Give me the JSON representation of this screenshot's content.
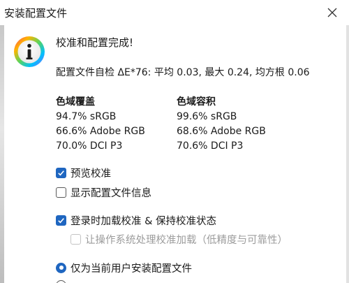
{
  "window": {
    "title": "安装配置文件"
  },
  "dialog": {
    "heading": "校准和配置完成!",
    "profile_check": "配置文件自检 ΔE*76: 平均 0.03, 最大 0.24, 均方根 0.06",
    "coverage": {
      "title": "色域覆盖",
      "srgb": "94.7% sRGB",
      "adobe": "66.6% Adobe RGB",
      "dci": "70.0% DCI P3"
    },
    "volume": {
      "title": "色域容积",
      "srgb": "99.6% sRGB",
      "adobe": "68.6% Adobe RGB",
      "dci": "70.6% DCI P3"
    },
    "options": {
      "preview_label": "预览校准",
      "preview_checked": true,
      "show_info_label": "显示配置文件信息",
      "show_info_checked": false,
      "load_on_login_label": "登录时加载校准 & 保持校准状态",
      "load_on_login_checked": true,
      "os_handle_label": "让操作系统处理校准加载（低精度与可靠性）",
      "os_handle_checked": false,
      "os_handle_disabled": true
    },
    "install_scope": {
      "current_user_label": "仅为当前用户安装配置文件",
      "current_user_selected": true,
      "system_default_selected": false
    }
  },
  "icons": {
    "info": "info-icon",
    "close": "close-icon"
  },
  "colors": {
    "accent": "#1f66c0",
    "disabled_text": "#9c9c9c"
  }
}
